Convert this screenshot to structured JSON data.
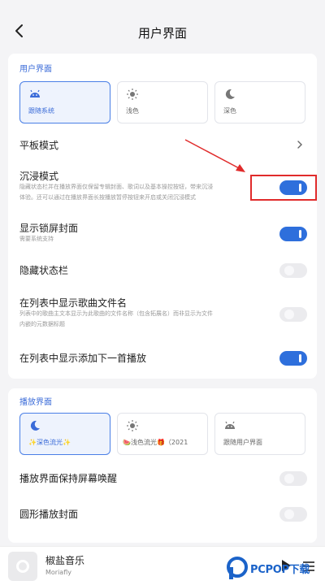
{
  "header": {
    "title": "用户界面"
  },
  "ui_section": {
    "label": "用户界面",
    "themes": [
      {
        "label": "跟随系统",
        "icon": "android-icon",
        "selected": true
      },
      {
        "label": "浅色",
        "icon": "sun-icon",
        "selected": false
      },
      {
        "label": "深色",
        "icon": "moon-icon",
        "selected": false
      }
    ],
    "tablet_mode": {
      "title": "平板模式"
    },
    "immersive_mode": {
      "title": "沉浸模式",
      "desc_line1": "隐藏状态栏并在播放界面仅保留专辑封面、歌词以及基本操控按钮，带来沉浸",
      "desc_line2": "体验。还可以通过在播放界面长按播放暂停按钮来开启或关闭沉浸模式",
      "enabled": true
    },
    "lockscreen_cover": {
      "title": "显示锁屏封面",
      "desc": "需要系统支持",
      "enabled": true
    },
    "hide_statusbar": {
      "title": "隐藏状态栏",
      "enabled": false
    },
    "show_filename": {
      "title": "在列表中显示歌曲文件名",
      "desc_line1": "列表中的歌曲主文本显示为此歌曲的文件名称（包含拓展名）而非显示为文件",
      "desc_line2": "内嵌的元数据标题",
      "enabled": false
    },
    "show_add_next": {
      "title": "在列表中显示添加下一首播放",
      "enabled": true
    }
  },
  "player_section": {
    "label": "播放界面",
    "themes": [
      {
        "label": "✨深色流光✨",
        "icon": "moon-icon",
        "selected": true
      },
      {
        "label": "🍉浅色流光🎁（2021",
        "icon": "sun-icon",
        "selected": false
      },
      {
        "label": "跟随用户界面",
        "icon": "android-icon",
        "selected": false
      }
    ],
    "keep_screen_on": {
      "title": "播放界面保持屏幕唤醒",
      "enabled": false
    },
    "round_cover": {
      "title": "圆形播放封面",
      "enabled": false
    }
  },
  "mini_player": {
    "song": "椒盐音乐",
    "artist": "Moriafly"
  },
  "watermark": {
    "text": "PCPOP下载"
  },
  "colors": {
    "accent": "#2e6fdc",
    "highlight": "#e02b2b",
    "label": "#3a6bd8"
  }
}
